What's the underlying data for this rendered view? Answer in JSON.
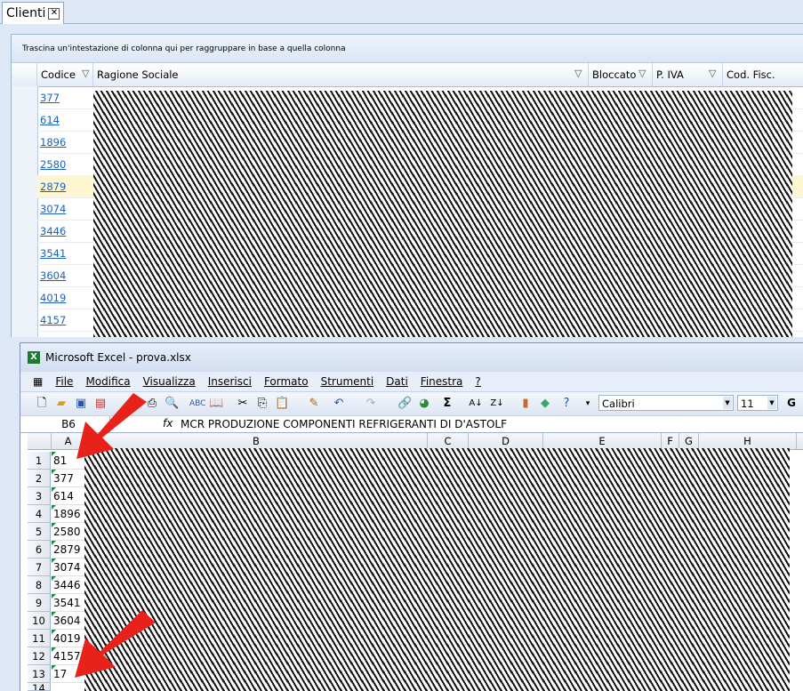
{
  "tab": {
    "title": "Clienti",
    "close": "✕"
  },
  "grid": {
    "group_hint": "Trascina un'intestazione di colonna qui per raggruppare in base a quella colonna",
    "columns": [
      "Codice",
      "Ragione Sociale",
      "Bloccato",
      "P. IVA",
      "Cod. Fisc."
    ],
    "codes": [
      "377",
      "614",
      "1896",
      "2580",
      "2879",
      "3074",
      "3446",
      "3541",
      "3604",
      "4019",
      "4157"
    ],
    "selected_code": "2879"
  },
  "excel": {
    "title": "Microsoft Excel - prova.xlsx",
    "menu": [
      "File",
      "Modifica",
      "Visualizza",
      "Inserisci",
      "Formato",
      "Strumenti",
      "Dati",
      "Finestra",
      "?"
    ],
    "font": "Calibri",
    "font_size": "11",
    "bold_label": "G",
    "name_box": "B6",
    "fx_label": "fx",
    "formula": "MCR PRODUZIONE COMPONENTI REFRIGERANTI DI D'ASTOLF",
    "columns": [
      "A",
      "B",
      "C",
      "D",
      "E",
      "F",
      "G",
      "H"
    ],
    "row_numbers": [
      "1",
      "2",
      "3",
      "4",
      "5",
      "6",
      "7",
      "8",
      "9",
      "10",
      "11",
      "12",
      "13",
      "14"
    ],
    "col_a": [
      "81",
      "377",
      "614",
      "1896",
      "2580",
      "2879",
      "3074",
      "3446",
      "3541",
      "3604",
      "4019",
      "4157",
      "17"
    ]
  },
  "annotations": {
    "arrow_color": "#e8221b"
  }
}
